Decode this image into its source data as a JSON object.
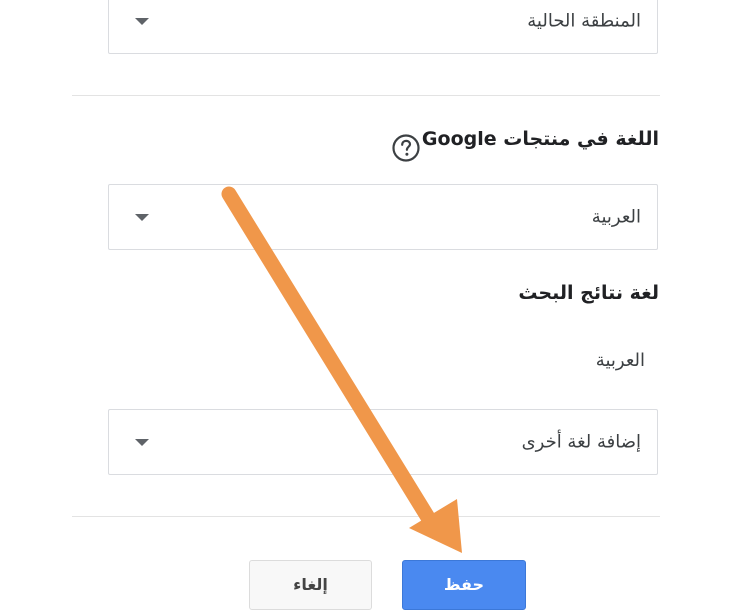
{
  "region_select": {
    "value": "المنطقة الحالية"
  },
  "google_language": {
    "heading_text": "اللغة في منتجات",
    "heading_brand": "Google",
    "help_icon": "question-circle-icon",
    "select_value": "العربية"
  },
  "search_results_language": {
    "heading": "لغة نتائج البحث",
    "current": "العربية",
    "add_select_value": "إضافة لغة أخرى"
  },
  "actions": {
    "save_label": "حفظ",
    "cancel_label": "إلغاء"
  },
  "colors": {
    "arrow": "#f0974a",
    "primary_button": "#4a89f0"
  }
}
